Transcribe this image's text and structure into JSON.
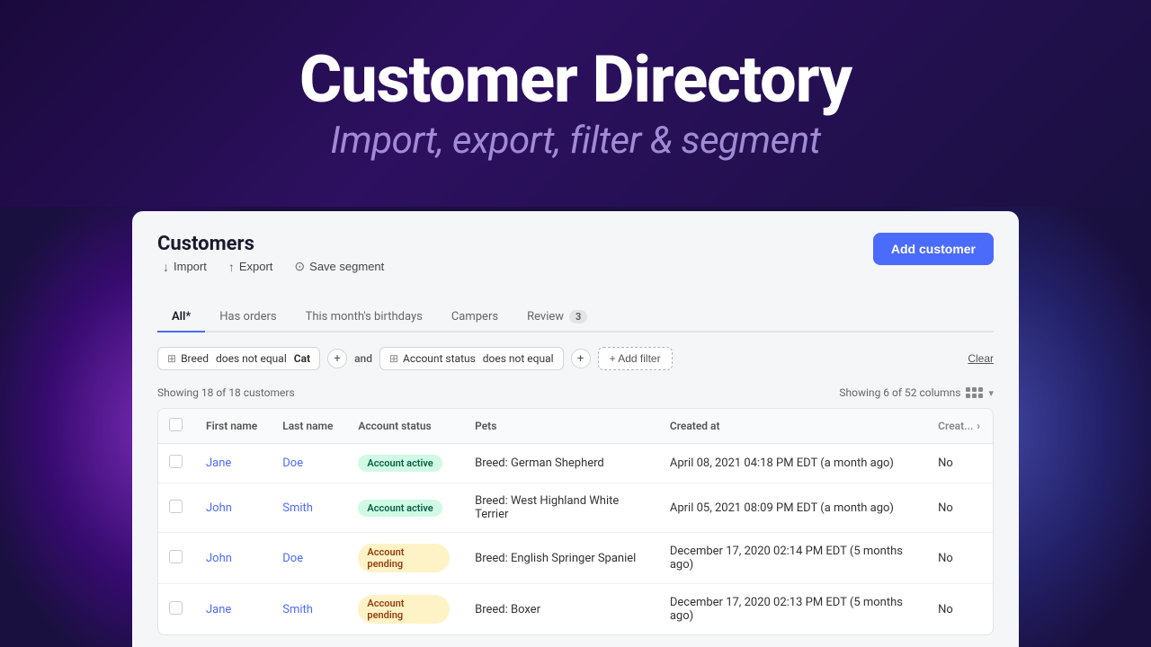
{
  "hero": {
    "title": "Customer Directory",
    "subtitle": "Import, export, filter & segment"
  },
  "page": {
    "title": "Customers"
  },
  "toolbar": {
    "import_label": "Import",
    "export_label": "Export",
    "save_segment_label": "Save segment"
  },
  "add_customer_btn": "Add customer",
  "tabs": [
    {
      "label": "All*",
      "active": true,
      "badge": null
    },
    {
      "label": "Has orders",
      "active": false,
      "badge": null
    },
    {
      "label": "This month's birthdays",
      "active": false,
      "badge": null
    },
    {
      "label": "Campers",
      "active": false,
      "badge": null
    },
    {
      "label": "Review",
      "active": false,
      "badge": "3"
    }
  ],
  "filters": {
    "filter1_icon": "⊞",
    "filter1_field": "Breed",
    "filter1_operator": "does not equal",
    "filter1_value": "Cat",
    "filter2_icon": "⊞",
    "filter2_field": "Account status",
    "filter2_operator": "does not equal",
    "filter2_value": "",
    "connector": "and",
    "add_filter_label": "+ Add filter",
    "clear_label": "Clear"
  },
  "table_meta": {
    "showing_label": "Showing 18 of 18 customers",
    "columns_label": "Showing 6 of 52 columns"
  },
  "columns": [
    "First name",
    "Last name",
    "Account status",
    "Pets",
    "Created at",
    "Creat..."
  ],
  "rows": [
    {
      "first_name": "Jane",
      "last_name": "Doe",
      "account_status": "Account active",
      "status_type": "active",
      "pets": "Breed: German Shepherd",
      "created_at": "April 08, 2021 04:18 PM EDT (a month ago)",
      "extra": "No"
    },
    {
      "first_name": "John",
      "last_name": "Smith",
      "account_status": "Account active",
      "status_type": "active",
      "pets": "Breed: West Highland White Terrier",
      "created_at": "April 05, 2021 08:09 PM EDT (a month ago)",
      "extra": "No"
    },
    {
      "first_name": "John",
      "last_name": "Doe",
      "account_status": "Account pending",
      "status_type": "pending",
      "pets": "Breed: English Springer Spaniel",
      "created_at": "December 17, 2020 02:14 PM EDT (5 months ago)",
      "extra": "No"
    },
    {
      "first_name": "Jane",
      "last_name": "Smith",
      "account_status": "Account pending",
      "status_type": "pending",
      "pets": "Breed: Boxer",
      "created_at": "December 17, 2020 02:13 PM EDT (5 months ago)",
      "extra": "No"
    }
  ]
}
